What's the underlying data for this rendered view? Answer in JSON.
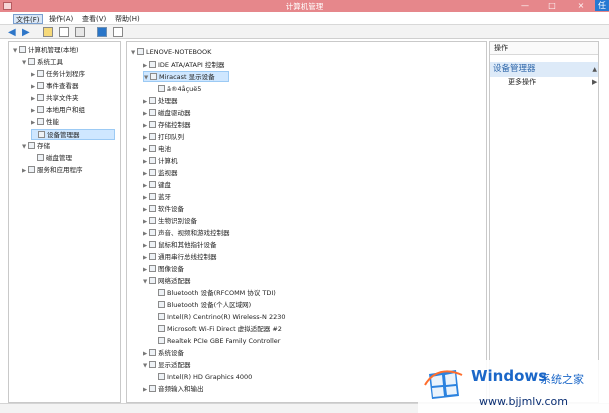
{
  "window": {
    "title": "计算机管理",
    "controls": [
      "—",
      "□",
      "×"
    ],
    "user_badge": "任"
  },
  "menu": [
    "文件(F)",
    "操作(A)",
    "查看(V)",
    "帮助(H)"
  ],
  "left_tree": [
    "计算机管理(本地)",
    "系统工具",
    "任务计划程序",
    "事件查看器",
    "共享文件夹",
    "本地用户和组",
    "性能",
    "设备管理器",
    "存储",
    "磁盘管理",
    "服务和应用程序"
  ],
  "device_tree": [
    "LENOVE-NOTEBOOK",
    "IDE ATA/ATAPI 控制器",
    "Miracast 显示设备",
    "ä®4åçuë5",
    "处理器",
    "磁盘驱动器",
    "存储控制器",
    "打印队列",
    "电池",
    "计算机",
    "监视器",
    "键盘",
    "蓝牙",
    "软件设备",
    "生物识别设备",
    "声音、视频和游戏控制器",
    "鼠标和其他指针设备",
    "通用串行总线控制器",
    "图像设备",
    "网络适配器",
    "Bluetooth 设备(RFCOMM 协议 TDI)",
    "Bluetooth 设备(个人区域网)",
    "Intel(R) Centrino(R) Wireless-N 2230",
    "Microsoft Wi-Fi Direct 虚拟适配器 #2",
    "Realtek PCIe GBE Family Controller",
    "系统设备",
    "显示适配器",
    "Intel(R) HD Graphics 4000",
    "音频输入和输出"
  ],
  "actions": {
    "header": "操作",
    "section": "设备管理器",
    "more": "更多操作"
  },
  "watermark": {
    "brand": "Windows",
    "cn": "系统之家",
    "url": "www.bjjmlv.com"
  }
}
